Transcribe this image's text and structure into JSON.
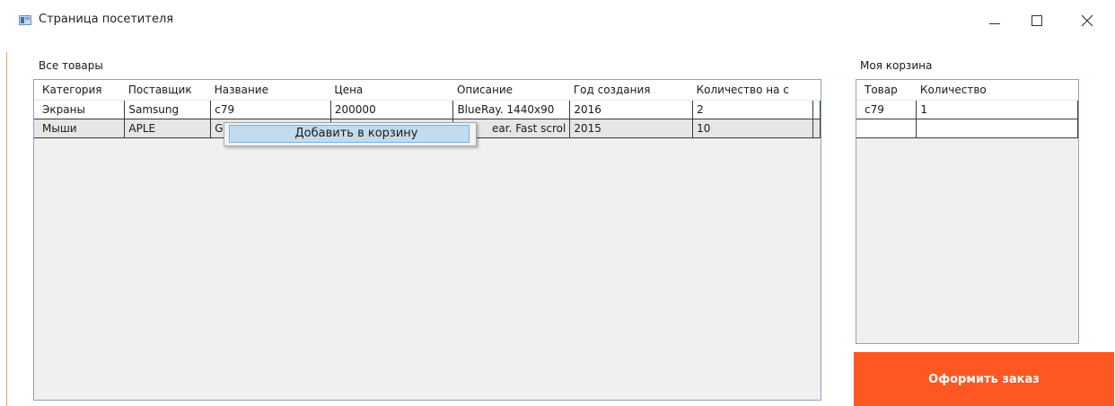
{
  "window": {
    "title": "Страница посетителя"
  },
  "all_products": {
    "label": "Все товары",
    "columns": [
      "Категория",
      "Поставщик",
      "Название",
      "Цена",
      "Описание",
      "Год создания",
      "Количество на с"
    ],
    "rows": [
      [
        "Экраны",
        "Samsung",
        "c79",
        "200000",
        "BlueRay. 1440x90",
        "2016",
        "2"
      ],
      [
        "Мыши",
        "APLE",
        "G",
        "",
        "ear. Fast scrol",
        "2015",
        "10"
      ]
    ]
  },
  "context_menu": {
    "item": "Добавить в корзину"
  },
  "cart": {
    "label": "Моя корзина",
    "columns": [
      "Товар",
      "Количество"
    ],
    "rows": [
      [
        "c79",
        "1"
      ],
      [
        "",
        ""
      ]
    ]
  },
  "order_button": "Оформить заказ",
  "colors": {
    "accent": "#ff5722",
    "grid_border": "#8ba4c0",
    "menu_highlight": "#c2dbee"
  }
}
